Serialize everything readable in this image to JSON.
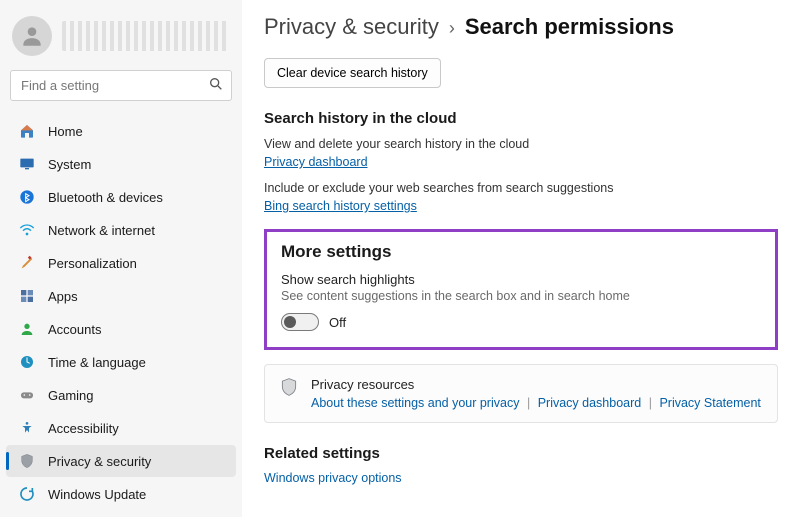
{
  "sidebar": {
    "search_placeholder": "Find a setting",
    "items": [
      {
        "label": "Home"
      },
      {
        "label": "System"
      },
      {
        "label": "Bluetooth & devices"
      },
      {
        "label": "Network & internet"
      },
      {
        "label": "Personalization"
      },
      {
        "label": "Apps"
      },
      {
        "label": "Accounts"
      },
      {
        "label": "Time & language"
      },
      {
        "label": "Gaming"
      },
      {
        "label": "Accessibility"
      },
      {
        "label": "Privacy & security"
      },
      {
        "label": "Windows Update"
      }
    ]
  },
  "breadcrumb": {
    "parent": "Privacy & security",
    "separator": "›",
    "current": "Search permissions"
  },
  "clear_button": "Clear device search history",
  "cloud_section": {
    "title": "Search history in the cloud",
    "line1": "View and delete your search history in the cloud",
    "link1": "Privacy dashboard",
    "line2": "Include or exclude your web searches from search suggestions",
    "link2": "Bing search history settings"
  },
  "more_settings": {
    "title": "More settings",
    "subtitle": "Show search highlights",
    "desc": "See content suggestions in the search box and in search home",
    "toggle_state": "Off"
  },
  "resources": {
    "title": "Privacy resources",
    "link1": "About these settings and your privacy",
    "link2": "Privacy dashboard",
    "link3": "Privacy Statement"
  },
  "related": {
    "title": "Related settings",
    "link1": "Windows privacy options"
  }
}
